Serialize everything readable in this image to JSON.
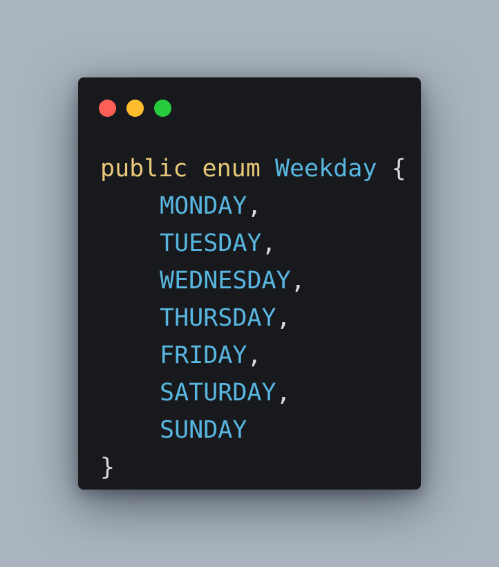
{
  "window": {
    "traffic_lights": [
      {
        "name": "close",
        "color": "#ff5f56"
      },
      {
        "name": "minimize",
        "color": "#ffbd2e"
      },
      {
        "name": "zoom",
        "color": "#27c93f"
      }
    ]
  },
  "code": {
    "colors": {
      "keyword": "#e8c97a",
      "type": "#58b6e0",
      "constant": "#58b6e0",
      "punctuation": "#d8dadc"
    },
    "keyword_public": "public",
    "keyword_enum": "enum",
    "type_name": "Weekday",
    "open_brace": "{",
    "close_brace": "}",
    "comma": ",",
    "constants": [
      "MONDAY",
      "TUESDAY",
      "WEDNESDAY",
      "THURSDAY",
      "FRIDAY",
      "SATURDAY",
      "SUNDAY"
    ]
  }
}
